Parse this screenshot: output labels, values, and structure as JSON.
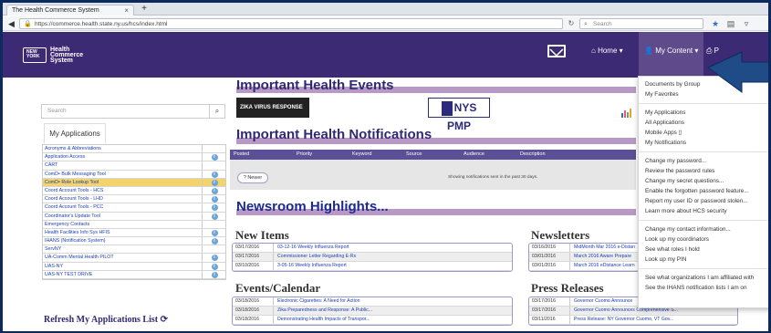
{
  "browser": {
    "tab_title": "The Health Commerce System",
    "tab_close": "×",
    "new_tab": "+",
    "url": "https://commerce.health.state.ny.us/hcs/index.html",
    "search_placeholder": "Search"
  },
  "header": {
    "logo_state": "New York State",
    "logo_lines": [
      "Health",
      "Commerce",
      "System"
    ],
    "nav_home": "Home",
    "nav_my_content": "My Content",
    "nav_print": "P"
  },
  "dropdown": {
    "groups": [
      [
        "Documents by Group",
        "My Favorites"
      ],
      [
        "My Applications",
        "All Applications",
        "Mobile Apps ▯",
        "My Notifications"
      ],
      [
        "Change my password...",
        "Review the password rules",
        "Change my secret questions...",
        "Enable the forgotten password feature...",
        "Report my user ID or password stolen...",
        "Learn more about HCS security"
      ],
      [
        "Change my contact information...",
        "Look up my coordinators",
        "See what roles I hold",
        "Look up my PIN"
      ],
      [
        "See what organizations I am affiliated with",
        "See the IHANS notification lists I am on"
      ]
    ]
  },
  "sidebar": {
    "search_placeholder": "Search",
    "my_applications_tab": "My Applications",
    "apps": [
      {
        "label": "Acronyms & Abbreviations",
        "info": false
      },
      {
        "label": "Application Access",
        "info": true
      },
      {
        "label": "CART",
        "info": false
      },
      {
        "label": "ComD• Bulk Messaging Tool",
        "info": true
      },
      {
        "label": "ComD• Role Lookup Tool",
        "info": true,
        "highlight": true
      },
      {
        "label": "Coord Account Tools - HCS",
        "info": true
      },
      {
        "label": "Coord Account Tools - LHD",
        "info": true
      },
      {
        "label": "Coord Account Tools - PCC",
        "info": true
      },
      {
        "label": "Coordinator's Update Tool",
        "info": true
      },
      {
        "label": "Emergency Contacts",
        "info": false
      },
      {
        "label": "Health Facilities Info Sys HFIS",
        "info": true
      },
      {
        "label": "IHANS (Notification System)",
        "info": true
      },
      {
        "label": "ServNY",
        "info": false
      },
      {
        "label": "UA-Comm Mental Health PILOT",
        "info": true
      },
      {
        "label": "UAS-NY",
        "info": true
      },
      {
        "label": "UAS-NY TEST DRIVE",
        "info": true
      }
    ],
    "refresh_label": "Refresh My Applications List"
  },
  "main": {
    "events_title": "Important Health Events",
    "zika_label": "ZIKA VIRUS RESPONSE",
    "nyspmp_label": "NYS PMP",
    "notifications_title": "Important Health Notifications",
    "notif_columns": [
      "Posted",
      "Priority",
      "Keyword",
      "Source",
      "Audience",
      "Description"
    ],
    "newer_button": "? Newer",
    "notif_note": "Showing notifications sent in the past 30 days.",
    "newsroom_title": "Newsroom Highlights...",
    "new_items_title": "New Items",
    "new_items": [
      {
        "date": "03/17/2016",
        "text": "03-12-16 Weekly Influenza Report"
      },
      {
        "date": "03/17/2016",
        "text": "Commissioner Letter Regarding E-Rx"
      },
      {
        "date": "03/10/2016",
        "text": "3-05-16 Weekly Influenza Report"
      }
    ],
    "newsletters_title": "Newsletters",
    "newsletters": [
      {
        "date": "03/16/2016",
        "text": "MidMonth Mar 2016 e-Distan"
      },
      {
        "date": "03/01/2016",
        "text": "March 2016 Aware Prepare"
      },
      {
        "date": "03/01/2016",
        "text": "March 2016 eDistance Learn"
      }
    ],
    "events_calendar_title": "Events/Calendar",
    "events": [
      {
        "date": "03/18/2016",
        "text": "Electronic Cigarettes: A Need for Action"
      },
      {
        "date": "03/18/2016",
        "text": "Zika Preparedness and Response: A Public..."
      },
      {
        "date": "03/18/2016",
        "text": "Demonstrating Health Impacts of Transpor..."
      }
    ],
    "press_title": "Press Releases",
    "press": [
      {
        "date": "03/17/2016",
        "text": "Governor Cuomo Announce"
      },
      {
        "date": "03/17/2016",
        "text": "Governor Cuomo Announces Comprehensive S..."
      },
      {
        "date": "03/11/2016",
        "text": "Press Release: NY Governor Cuomo, VT Gov..."
      }
    ]
  }
}
